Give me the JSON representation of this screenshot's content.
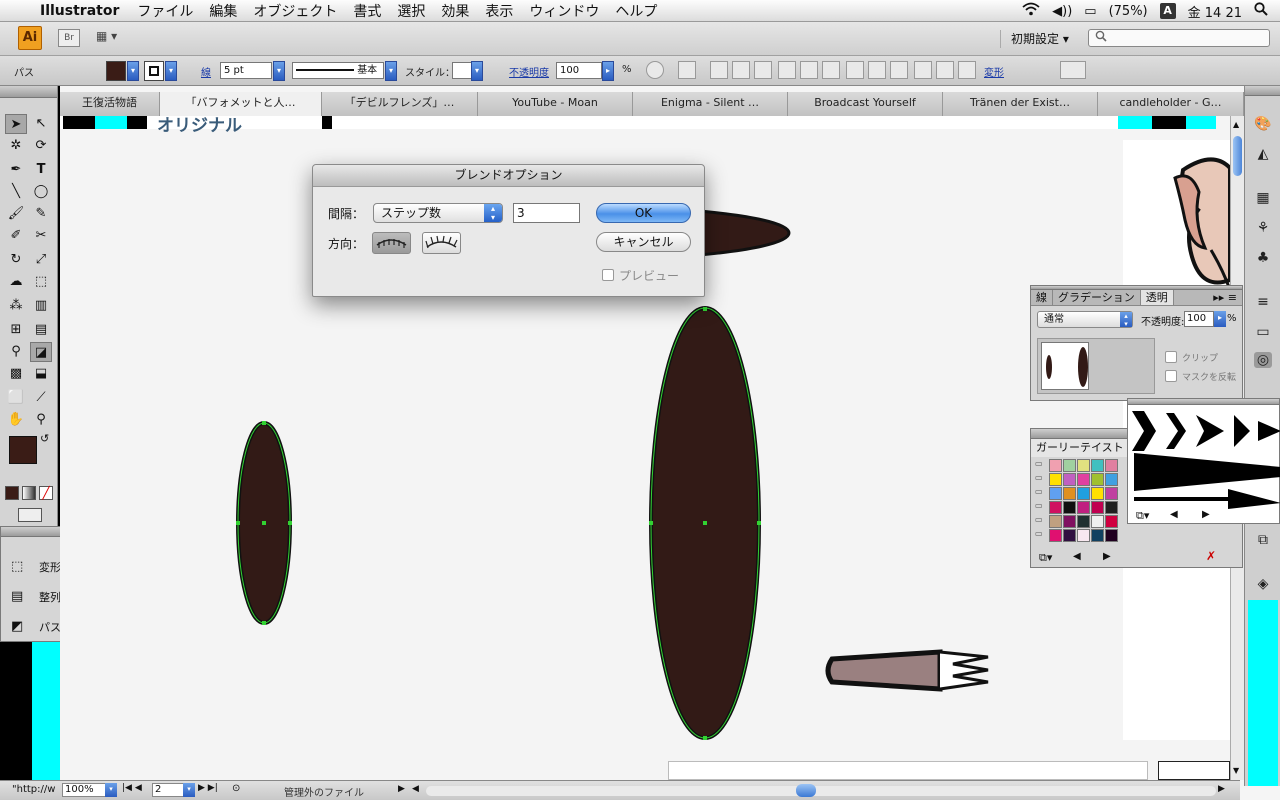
{
  "menubar": {
    "app": "Illustrator",
    "items": [
      "ファイル",
      "編集",
      "オブジェクト",
      "書式",
      "選択",
      "効果",
      "表示",
      "ウィンドウ",
      "ヘルプ"
    ],
    "battery": "(75%)",
    "input_icon": "A",
    "clock": "金 14 21"
  },
  "appbar": {
    "logo": "Ai",
    "bridge": "Br",
    "workspace": "初期設定 ▾"
  },
  "control": {
    "selection_label": "パス",
    "fill_color": "#3a1c16",
    "stroke_label": "線",
    "stroke_weight": "5 pt",
    "stroke_profile": "基本",
    "style_label": "スタイル：",
    "opacity_label": "不透明度",
    "opacity_value": "100",
    "opacity_unit": "%",
    "transform_link": "変形"
  },
  "tabs": [
    {
      "label": "王復活物語",
      "active": false
    },
    {
      "label": "「バフォメットと人…",
      "active": true
    },
    {
      "label": "「デビルフレンズ」…",
      "active": false
    },
    {
      "label": "YouTube - Moan",
      "active": false
    },
    {
      "label": "Enigma - Silent …",
      "active": false
    },
    {
      "label": "Broadcast Yourself",
      "active": false
    },
    {
      "label": "Tränen der Exist…",
      "active": false
    },
    {
      "label": "candleholder - G…",
      "active": false
    }
  ],
  "page_heading": "オリジナル",
  "dialog": {
    "title": "ブレンドオプション",
    "spacing_label": "間隔：",
    "spacing_value": "ステップ数",
    "steps_value": "3",
    "orientation_label": "方向：",
    "ok_label": "OK",
    "cancel_label": "キャンセル",
    "preview_label": "プレビュー"
  },
  "transparency_panel": {
    "tabs": [
      "線",
      "グラデーション",
      "透明"
    ],
    "blend_mode": "通常",
    "opacity_label": "不透明度:",
    "opacity_value": "100",
    "opacity_unit": "%",
    "clip_label": "クリップ",
    "invert_mask_label": "マスクを反転"
  },
  "swatch_panel": {
    "title": "ガーリーテイスト"
  },
  "left_mini_panel": {
    "items": [
      "変形",
      "整列",
      "パスファインダ"
    ]
  },
  "status": {
    "url_prefix": "\"http://w",
    "zoom": "100%",
    "page": "2",
    "file_status": "管理外のファイル"
  },
  "colors": {
    "ellipse_fill": "#321a16",
    "selection_green": "#32d232",
    "cyan": "#00ffff",
    "brush_fill": "#9a8080"
  }
}
